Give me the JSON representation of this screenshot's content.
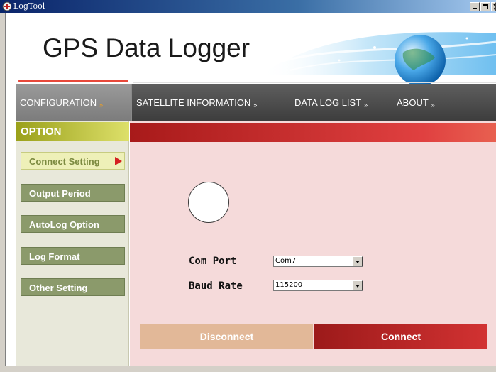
{
  "window": {
    "title": "LogTool"
  },
  "header": {
    "title": "GPS Data Logger"
  },
  "nav": {
    "tabs": [
      {
        "label": "CONFIGURATION",
        "active": true
      },
      {
        "label": "SATELLITE  INFORMATION",
        "active": false
      },
      {
        "label": "DATA  LOG  LIST",
        "active": false
      },
      {
        "label": "ABOUT",
        "active": false
      }
    ],
    "chevron": "»"
  },
  "sidebar": {
    "heading": "OPTION",
    "items": [
      {
        "label": "Connect  Setting",
        "active": true
      },
      {
        "label": "Output  Period",
        "active": false
      },
      {
        "label": "AutoLog  Option",
        "active": false
      },
      {
        "label": "Log  Format",
        "active": false
      },
      {
        "label": "Other  Setting",
        "active": false
      }
    ]
  },
  "connection": {
    "com_port_label": "Com Port",
    "com_port_value": "Com7",
    "baud_rate_label": "Baud Rate",
    "baud_rate_value": "115200",
    "disconnect_label": "Disconnect",
    "connect_label": "Connect"
  },
  "colors": {
    "accent_red": "#d23232",
    "sidebar_green": "#8b9a6b",
    "panel_bg": "#f5dada",
    "nav_dark": "#4a4a4a"
  }
}
